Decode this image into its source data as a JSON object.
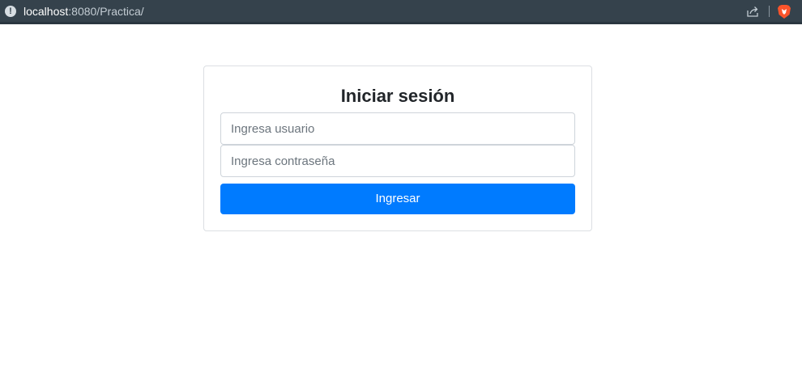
{
  "browser": {
    "url_host": "localhost",
    "url_rest": ":8080/Practica/",
    "info_icon": "info-circle-icon",
    "share_icon": "share-icon",
    "brave_icon": "brave-lion-icon",
    "bar_color": "#35424c"
  },
  "login": {
    "title": "Iniciar sesión",
    "username_placeholder": "Ingresa usuario",
    "username_value": "",
    "password_placeholder": "Ingresa contraseña",
    "password_value": "",
    "submit_label": "Ingresar",
    "submit_color": "#007bff"
  }
}
